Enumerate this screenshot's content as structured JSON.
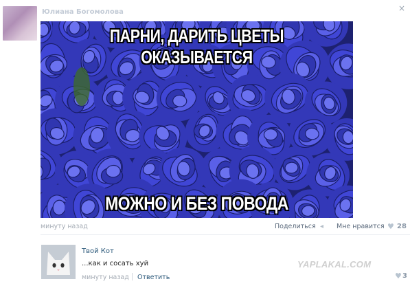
{
  "post": {
    "author": "Юлиана Богомолова",
    "close_glyph": "×",
    "meme_top": "ПАРНИ, ДАРИТЬ ЦВЕТЫ ОКАЗЫВАЕТСЯ",
    "meme_bottom": "МОЖНО И БЕЗ ПОВОДА",
    "time": "минуту назад",
    "share_label": "Поделиться",
    "like_label": "Мне нравится",
    "like_count": "28"
  },
  "comment": {
    "author": "Твой Кот",
    "text": "...как и сосать хуй",
    "time": "минуту назад",
    "reply_label": "Ответить",
    "like_count": "3"
  },
  "watermark": "YAPLAKAL.COM",
  "colors": {
    "link": "#2b587a",
    "roses": "#3a3fd0"
  }
}
